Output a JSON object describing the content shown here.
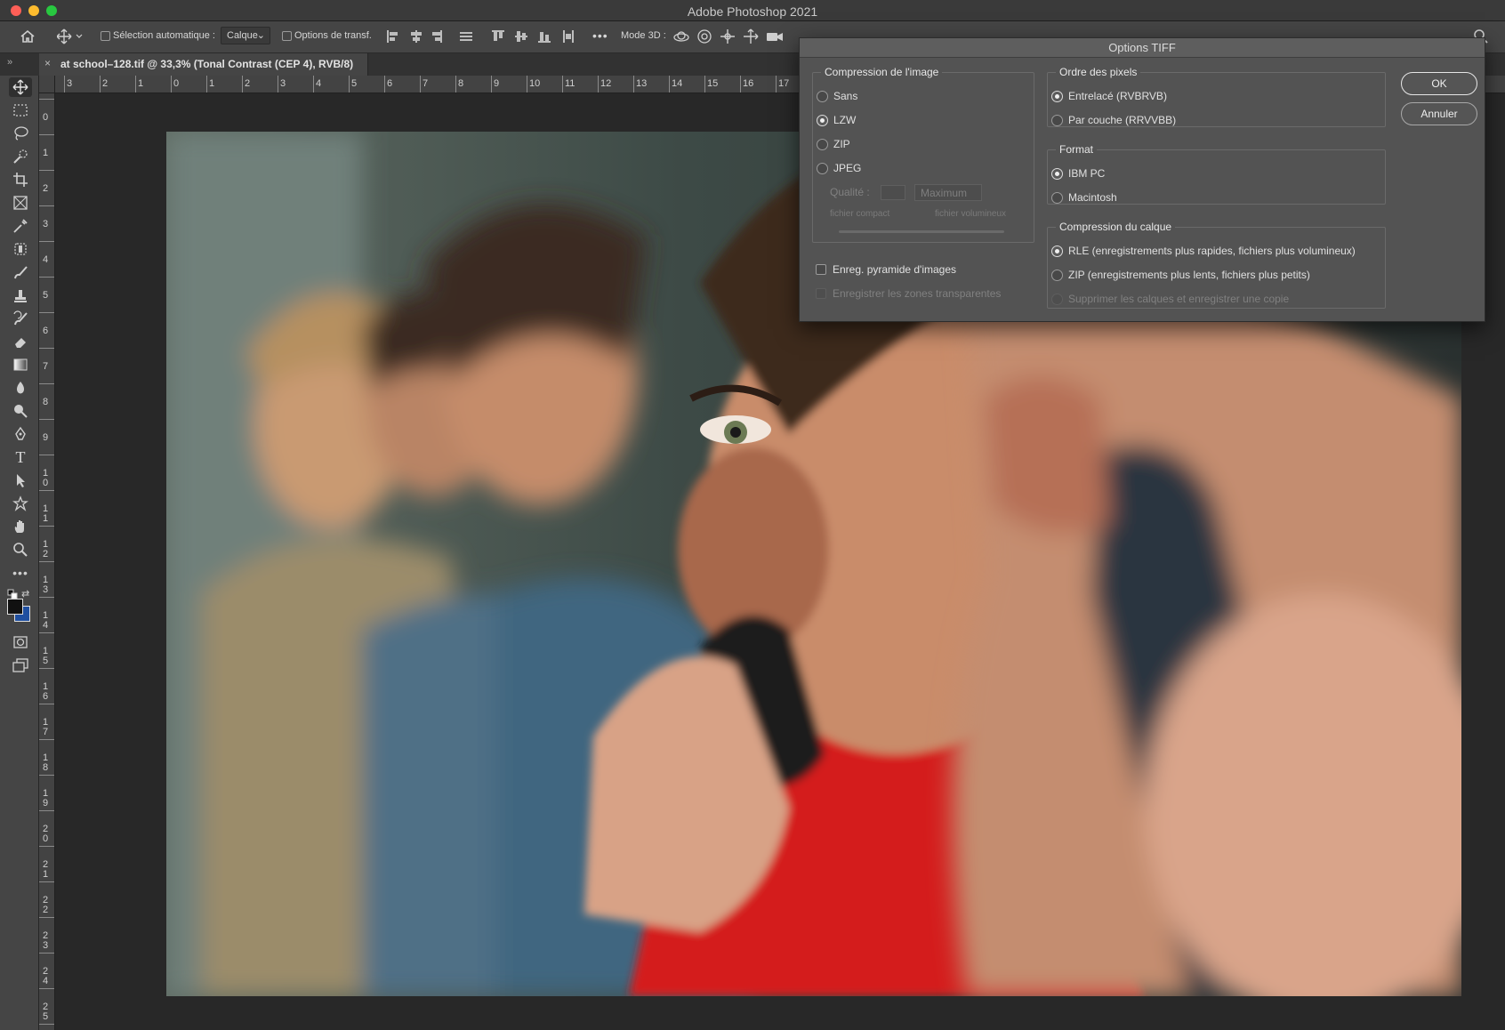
{
  "app": {
    "title": "Adobe Photoshop 2021"
  },
  "options_bar": {
    "auto_select_label": "Sélection automatique :",
    "auto_select_value": "Calque",
    "transform_options_label": "Options de transf.",
    "more_label": "•••",
    "mode3d_label": "Mode 3D :"
  },
  "document": {
    "tab_title": "at school–128.tif @ 33,3% (Tonal Contrast (CEP 4), RVB/8)",
    "close_glyph": "×"
  },
  "rulers": {
    "horizontal": [
      "3",
      "2",
      "1",
      "0",
      "1",
      "2",
      "3",
      "4",
      "5",
      "6",
      "7",
      "8",
      "9",
      "10",
      "11",
      "12",
      "13",
      "14",
      "15",
      "16",
      "17"
    ],
    "vertical": [
      "1",
      "0",
      "1",
      "2",
      "3",
      "4",
      "5",
      "6",
      "7",
      "8",
      "9",
      "1 0",
      "1 1",
      "1 2",
      "1 3",
      "1 4",
      "1 5",
      "1 6",
      "1 7",
      "1 8",
      "1 9",
      "2 0",
      "2 1",
      "2 2",
      "2 3",
      "2 4",
      "2 5"
    ]
  },
  "dialog": {
    "title": "Options TIFF",
    "ok_label": "OK",
    "cancel_label": "Annuler",
    "image_compression": {
      "title": "Compression de l'image",
      "options": [
        {
          "label": "Sans",
          "selected": false
        },
        {
          "label": "LZW",
          "selected": true
        },
        {
          "label": "ZIP",
          "selected": false
        },
        {
          "label": "JPEG",
          "selected": false
        }
      ],
      "quality_label": "Qualité :",
      "quality_value": "Maximum",
      "small_file_label": "fichier compact",
      "large_file_label": "fichier volumineux",
      "pyramid_label": "Enreg. pyramide d'images",
      "transparency_label": "Enregistrer les zones transparentes"
    },
    "pixel_order": {
      "title": "Ordre des pixels",
      "options": [
        {
          "label": "Entrelacé (RVBRVB)",
          "selected": true
        },
        {
          "label": "Par couche (RRVVBB)",
          "selected": false
        }
      ]
    },
    "byte_order": {
      "title": "Format",
      "options": [
        {
          "label": "IBM PC",
          "selected": true
        },
        {
          "label": "Macintosh",
          "selected": false
        }
      ]
    },
    "layer_compression": {
      "title": "Compression du calque",
      "options": [
        {
          "label": "RLE (enregistrements plus rapides, fichiers plus volumineux)",
          "selected": true
        },
        {
          "label": "ZIP (enregistrements plus lents, fichiers plus petits)",
          "selected": false
        }
      ],
      "discard_label": "Supprimer les calques et enregistrer une copie"
    }
  },
  "colors": {
    "accent_close": "#fe5f57",
    "accent_min": "#febc2e",
    "accent_max": "#28c840",
    "foreground_swatch": "#111111",
    "background_swatch": "#1f4fa0"
  }
}
